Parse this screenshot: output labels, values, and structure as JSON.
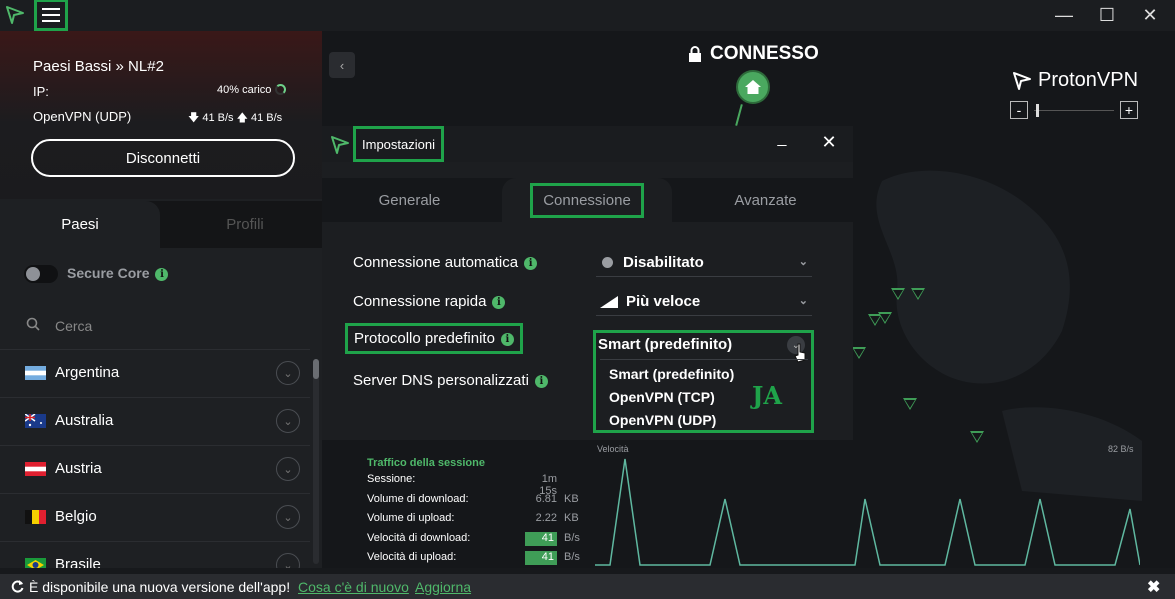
{
  "window": {
    "minimize": "—",
    "maximize": "☐",
    "close": "✕"
  },
  "connection": {
    "server": "Paesi Bassi » NL#2",
    "ip_label": "IP:",
    "load": "40% carico",
    "protocol": "OpenVPN (UDP)",
    "speeds": "🡇 41 B/s 🡅 41 B/s",
    "disconnect_label": "Disconnetti"
  },
  "sidebar": {
    "tabs": [
      "Paesi",
      "Profili"
    ],
    "secure_core_label": "Secure Core",
    "search_placeholder": "Cerca",
    "countries": [
      "Argentina",
      "Australia",
      "Austria",
      "Belgio",
      "Brasile"
    ]
  },
  "map": {
    "status": "CONNESSO",
    "brand": "ProtonVPN",
    "zoom_out": "-",
    "zoom_in": "+"
  },
  "dialog": {
    "title": "Impostazioni",
    "minimize": "_",
    "close": "✕",
    "tabs": [
      "Generale",
      "Connessione",
      "Avanzate"
    ],
    "settings": [
      {
        "label": "Connessione automatica",
        "value": "Disabilitato"
      },
      {
        "label": "Connessione rapida",
        "value": "Più veloce"
      },
      {
        "label": "Protocollo predefinito",
        "value": "Smart (predefinito)"
      },
      {
        "label": "Server DNS personalizzati",
        "value": ""
      }
    ],
    "protocol_options": [
      "Smart (predefinito)",
      "OpenVPN (TCP)",
      "OpenVPN (UDP)"
    ],
    "annotation": "JA"
  },
  "stats": {
    "title": "Traffico della sessione",
    "rows": [
      {
        "k": "Sessione:",
        "v": "1m 15s",
        "u": ""
      },
      {
        "k": "Volume di download:",
        "v": "6.81",
        "u": "KB"
      },
      {
        "k": "Volume di upload:",
        "v": "2.22",
        "u": "KB"
      },
      {
        "k": "Velocità di download:",
        "v": "41",
        "u": "B/s"
      },
      {
        "k": "Velocità di upload:",
        "v": "41",
        "u": "B/s"
      }
    ],
    "graph_title": "Velocità",
    "graph_max": "82  B/s"
  },
  "banner": {
    "text": "È disponibile una nuova versione dell'app!",
    "link1": "Cosa c'è di nuovo",
    "link2": "Aggiorna",
    "close": "✖"
  },
  "colors": {
    "accent": "#4fb86a",
    "highlight": "#1fa34a",
    "background": "#17191c"
  },
  "icons": [
    "proton-logo-icon",
    "hamburger-menu-icon",
    "lock-icon",
    "home-icon",
    "search-icon",
    "info-icon",
    "chevron-down-icon",
    "refresh-icon",
    "close-icon"
  ]
}
